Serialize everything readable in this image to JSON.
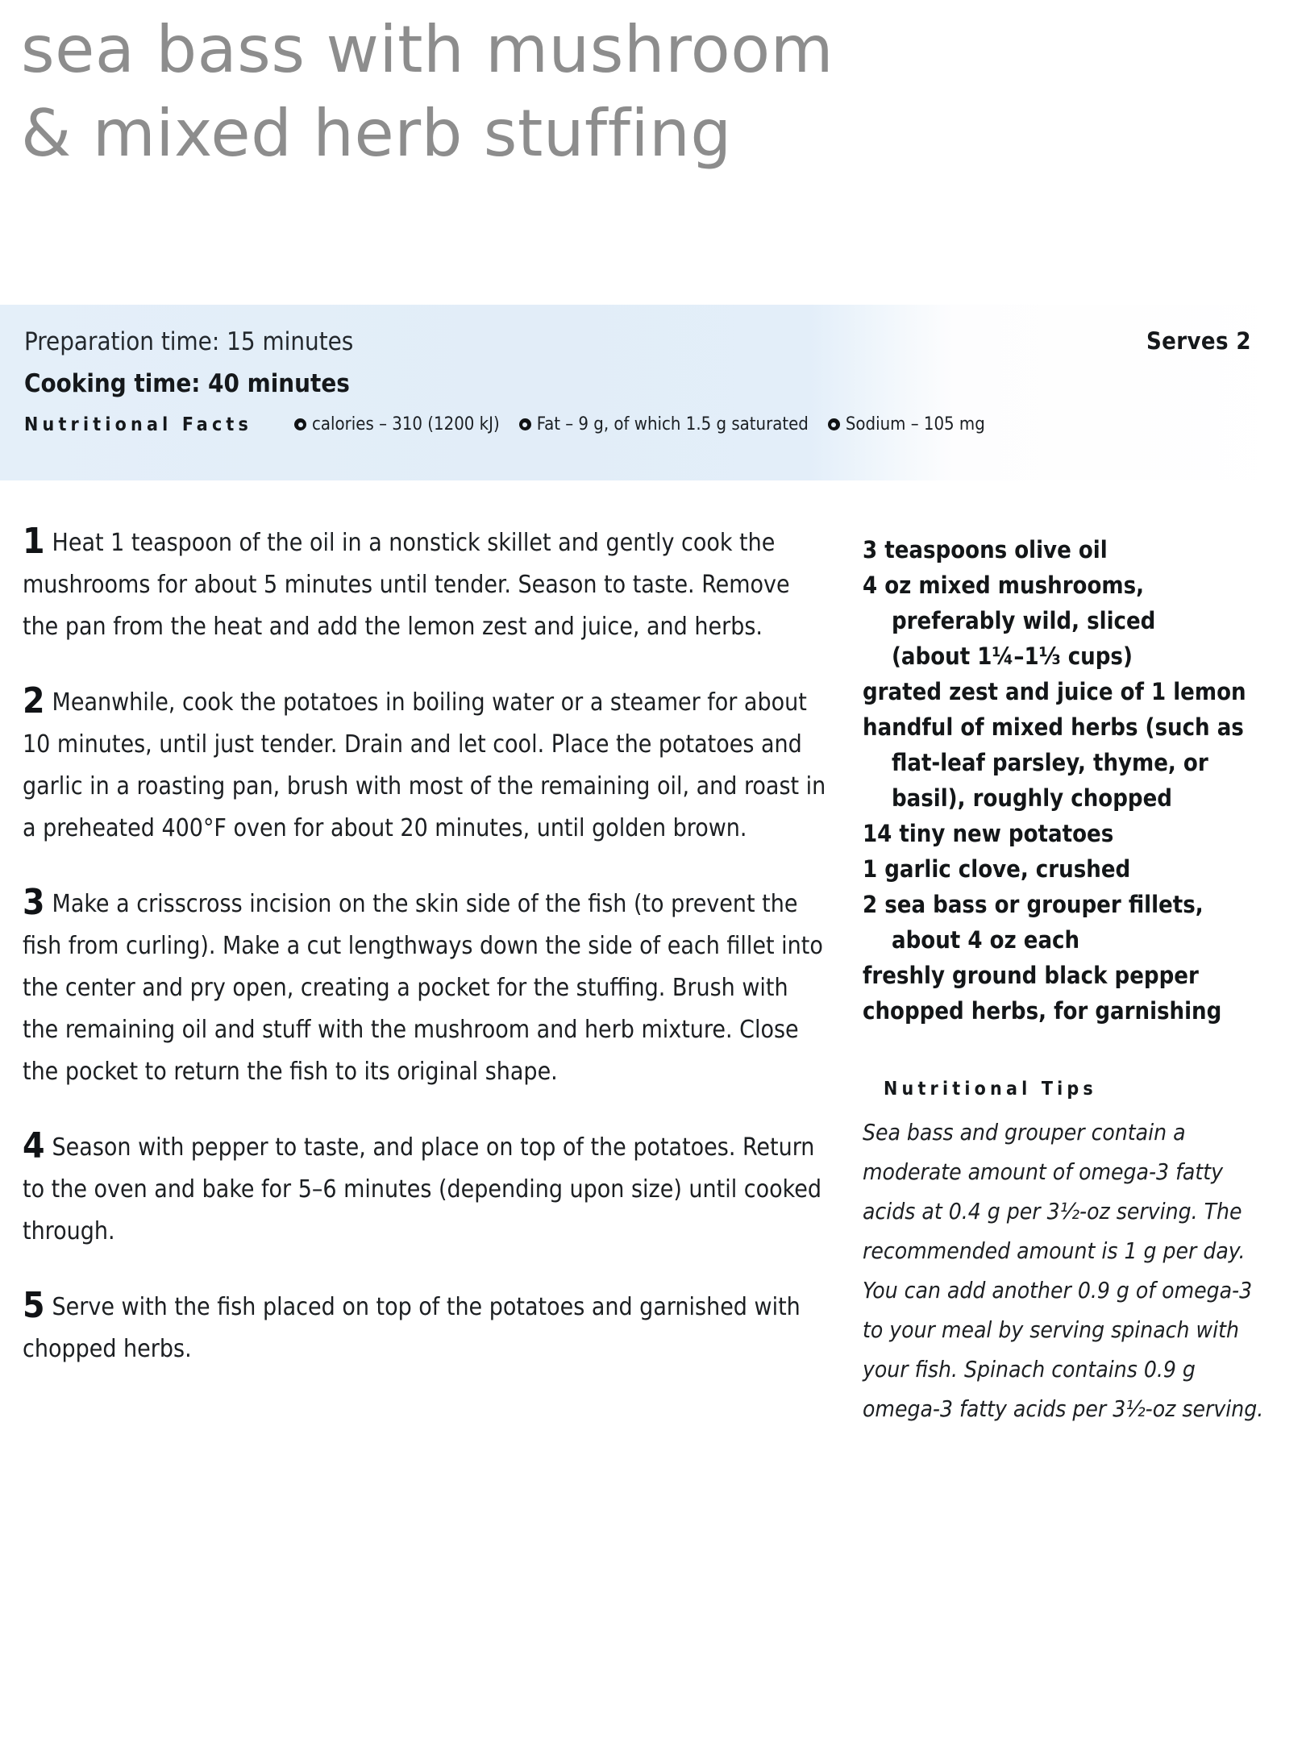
{
  "recipe": {
    "title_line_1": "sea bass with mushroom",
    "title_line_2": "& mixed herb stuffing"
  },
  "banner": {
    "prep_time": "Preparation time: 15 minutes",
    "cooking_time": "Cooking time: 40 minutes",
    "serves": "Serves 2",
    "nutritional_facts_label": "Nutritional Facts",
    "facts": [
      {
        "icon": "bullet-ring-icon",
        "text": "calories – 310 (1200 kJ)"
      },
      {
        "icon": "bullet-ring-icon",
        "text": "Fat – 9 g, of which 1.5 g saturated"
      },
      {
        "icon": "bullet-ring-icon",
        "text": "Sodium – 105 mg"
      }
    ]
  },
  "method": {
    "steps": [
      {
        "number": "1",
        "text": "Heat 1 teaspoon of the oil in a nonstick skillet and gently cook the mushrooms for about 5 minutes until tender. Season to taste. Remove the pan from the heat and add the lemon zest and juice, and herbs."
      },
      {
        "number": "2",
        "text": "Meanwhile, cook the potatoes in boiling water or a steamer for about 10 minutes, until just tender. Drain and let cool. Place the potatoes and garlic in a roasting pan, brush with most of the remaining oil, and roast in a preheated 400°F oven for about 20 minutes, until golden brown."
      },
      {
        "number": "3",
        "text": "Make a crisscross incision on the skin side of the fish (to prevent the fish from curling). Make a cut lengthways down the side of each fillet into the center and pry open, creating a pocket for the stuffing. Brush with the remaining oil and stuff with the mushroom and herb mixture. Close the pocket to return the fish to its original shape."
      },
      {
        "number": "4",
        "text": "Season with pepper to taste, and place on top of the potatoes. Return to the oven and bake for 5–6 minutes (depending upon size) until cooked through."
      },
      {
        "number": "5",
        "text": "Serve with the fish placed on top of the potatoes and garnished with chopped herbs."
      }
    ]
  },
  "ingredients": {
    "items": [
      {
        "main": "3 teaspoons olive oil",
        "cont": []
      },
      {
        "main": "4 oz mixed mushrooms,",
        "cont": [
          "preferably wild, sliced",
          "(about 1¼–1⅓ cups)"
        ]
      },
      {
        "main": "grated zest and juice of 1 lemon",
        "cont": []
      },
      {
        "main": "handful of mixed herbs (such as",
        "cont": [
          "flat-leaf parsley, thyme, or",
          "basil), roughly chopped"
        ]
      },
      {
        "main": "14 tiny new potatoes",
        "cont": []
      },
      {
        "main": "1 garlic clove, crushed",
        "cont": []
      },
      {
        "main": "2 sea bass or grouper fillets,",
        "cont": [
          "about 4 oz each"
        ]
      },
      {
        "main": "freshly ground black pepper",
        "cont": []
      },
      {
        "main": "chopped herbs, for garnishing",
        "cont": []
      }
    ]
  },
  "tips": {
    "heading": "Nutritional Tips",
    "body": "Sea bass and grouper contain a moderate amount of omega-3 fatty acids at 0.4 g per 3½-oz serving. The recommended amount is 1 g per day. You can add another 0.9 g of omega-3 to your meal by serving spinach with your fish. Spinach contains 0.9 g omega-3 fatty acids per 3½-oz serving."
  }
}
